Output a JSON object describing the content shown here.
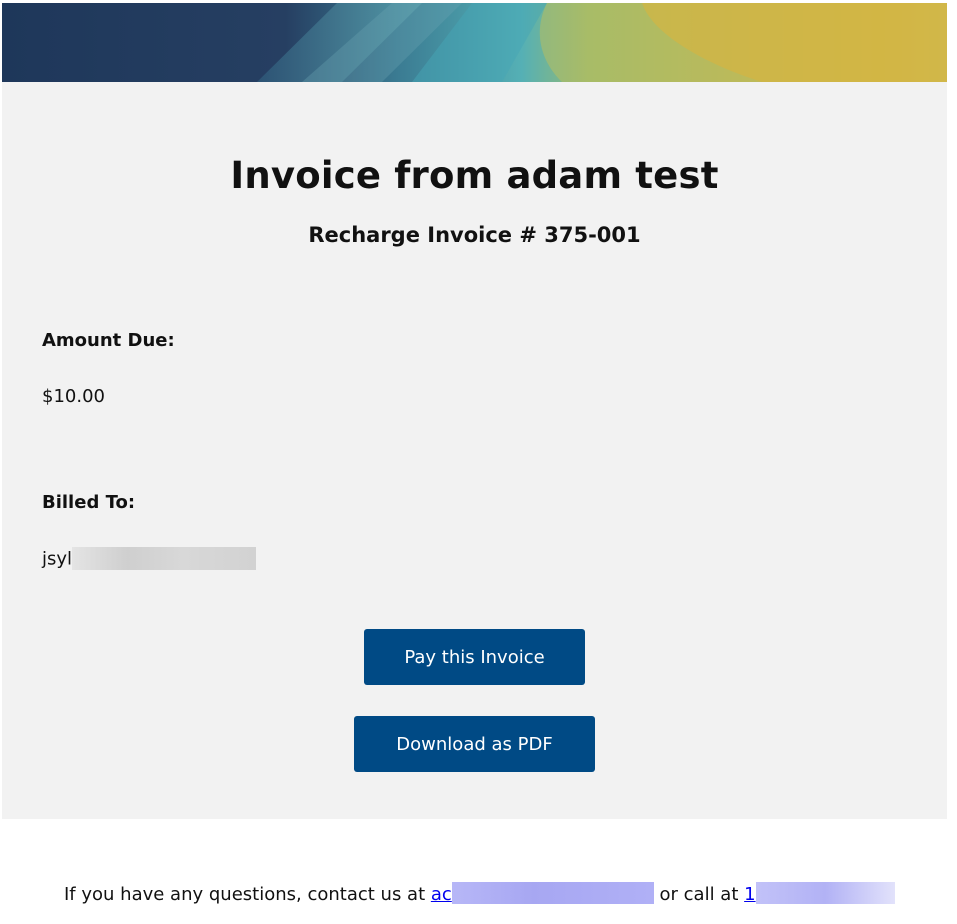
{
  "banner": {
    "colors": {
      "navy": "#213d5f",
      "teal": "#4aa0ad",
      "green": "#a6b962",
      "gold": "#ddb53d"
    }
  },
  "invoice": {
    "title": "Invoice from adam test",
    "subtitle": "Recharge Invoice # 375-001",
    "amount_label": "Amount Due:",
    "amount_value": "$10.00",
    "billed_label": "Billed To:",
    "billed_value_visible": "jsyl"
  },
  "actions": {
    "pay_label": "Pay this Invoice",
    "pdf_label": "Download as PDF"
  },
  "footer": {
    "text_before": "If you have any questions, contact us at ",
    "email_visible": "ac",
    "text_middle": " or call at ",
    "phone_visible": "1"
  },
  "colors": {
    "card_bg": "#f2f2f2",
    "button_bg": "#004a85",
    "button_text": "#ffffff",
    "link": "#0000ee"
  }
}
